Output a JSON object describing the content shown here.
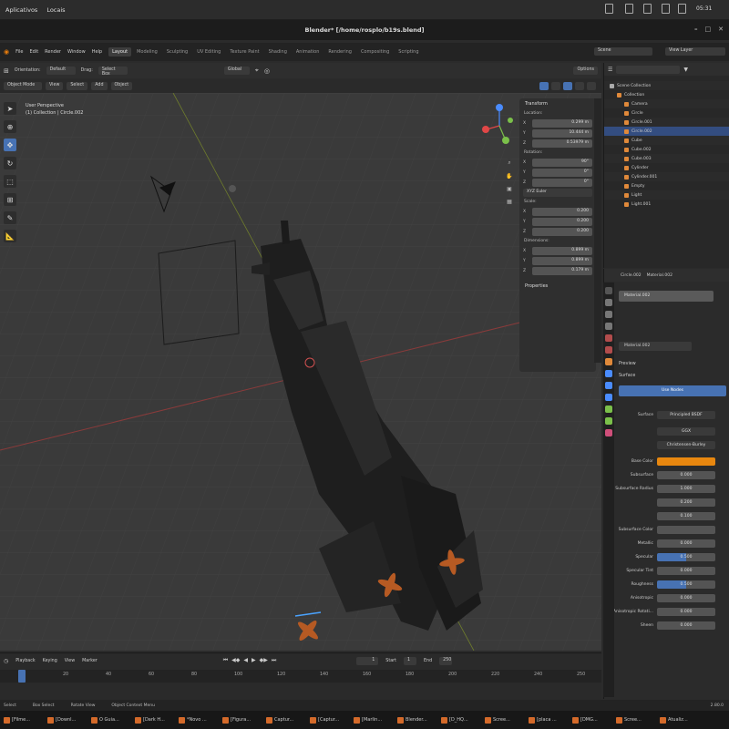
{
  "topbar": {
    "activities": "Aplicativos",
    "places": "Locais",
    "clock": "05:31"
  },
  "window": {
    "title": "Blender* [/home/rosplo/b19s.blend]"
  },
  "menu": {
    "items": [
      "File",
      "Edit",
      "Render",
      "Window",
      "Help"
    ]
  },
  "workspaces": [
    {
      "label": "Layout",
      "active": true
    },
    {
      "label": "Modeling"
    },
    {
      "label": "Sculpting"
    },
    {
      "label": "UV Editing"
    },
    {
      "label": "Texture Paint"
    },
    {
      "label": "Shading"
    },
    {
      "label": "Animation"
    },
    {
      "label": "Rendering"
    },
    {
      "label": "Compositing"
    },
    {
      "label": "Scripting"
    }
  ],
  "scene": {
    "scene_name": "Scene",
    "view_layer": "View Layer"
  },
  "header3d": {
    "orientation": "Orientation:",
    "orientation_val": "Default",
    "drag": "Drag:",
    "drag_val": "Select Box",
    "transform": "Global",
    "options": "Options"
  },
  "header3d2": {
    "mode": "Object Mode",
    "view": "View",
    "select": "Select",
    "add": "Add",
    "object": "Object"
  },
  "viewport": {
    "view_name": "User Perspective",
    "collection": "(1) Collection | Circle.002"
  },
  "npanel": {
    "title": "Transform",
    "location": "Location:",
    "loc": [
      "0.299 m",
      "10.444 m",
      "0.53979 m"
    ],
    "rotation": "Rotation:",
    "rot": [
      "90°",
      "0°",
      "0°"
    ],
    "rot_mode": "XYZ Euler",
    "scale": "Scale:",
    "scl": [
      "0.200",
      "0.200",
      "0.200"
    ],
    "dimensions": "Dimensions:",
    "dim": [
      "0.899 m",
      "0.899 m",
      "0.179 m"
    ],
    "properties": "Properties",
    "axes": [
      "X",
      "Y",
      "Z"
    ]
  },
  "outliner": {
    "items": [
      {
        "label": "Scene Collection",
        "indent": 0
      },
      {
        "label": "Collection",
        "indent": 1
      },
      {
        "label": "Camera",
        "indent": 2
      },
      {
        "label": "Circle",
        "indent": 2
      },
      {
        "label": "Circle.001",
        "indent": 2
      },
      {
        "label": "Circle.002",
        "indent": 2
      },
      {
        "label": "Cube",
        "indent": 2
      },
      {
        "label": "Cube.002",
        "indent": 2
      },
      {
        "label": "Cube.003",
        "indent": 2
      },
      {
        "label": "Cylinder",
        "indent": 2
      },
      {
        "label": "Cylinder.001",
        "indent": 2
      },
      {
        "label": "Empty",
        "indent": 2
      },
      {
        "label": "Light",
        "indent": 2
      },
      {
        "label": "Light.001",
        "indent": 2
      }
    ]
  },
  "properties": {
    "object": "Circle.002",
    "material_tab": "Material.002",
    "slot": "Material.002",
    "material": "Material.002",
    "preview": "Preview",
    "surface_section": "Surface",
    "use_nodes": "Use Nodes",
    "surface": "Surface",
    "surface_val": "Principled BSDF",
    "distribution": "GGX",
    "subsurface_method": "Christensen-Burley",
    "base_color_hex": "#e8870f",
    "rows": [
      {
        "label": "Base Color",
        "val": ""
      },
      {
        "label": "Subsurface",
        "val": "0.000"
      },
      {
        "label": "Subsurface Radius",
        "val": "1.000"
      },
      {
        "label": "",
        "val": "0.200"
      },
      {
        "label": "",
        "val": "0.100"
      },
      {
        "label": "Subsurface Color",
        "val": ""
      },
      {
        "label": "Metallic",
        "val": "0.000"
      },
      {
        "label": "Specular",
        "val": "0.500"
      },
      {
        "label": "Specular Tint",
        "val": "0.000"
      },
      {
        "label": "Roughness",
        "val": "0.500"
      },
      {
        "label": "Anisotropic",
        "val": "0.000"
      },
      {
        "label": "Anisotropic Rotati...",
        "val": "0.000"
      },
      {
        "label": "Sheen",
        "val": "0.000"
      }
    ]
  },
  "timeline": {
    "playback": "Playback",
    "keying": "Keying",
    "view": "View",
    "marker": "Marker",
    "current": "1",
    "start_label": "Start",
    "start": "1",
    "end_label": "End",
    "end": "250",
    "ticks": [
      "0",
      "20",
      "40",
      "60",
      "80",
      "100",
      "120",
      "140",
      "160",
      "180",
      "200",
      "220",
      "240",
      "250"
    ]
  },
  "statusbar": {
    "items": [
      "Select",
      "Box Select",
      "Rotate View",
      "Object Context Menu"
    ],
    "version": "2.80.0"
  },
  "taskbar": [
    "[Filme...",
    "[Downl...",
    "O Guia...",
    "[Dark H...",
    "*Novo ...",
    "[Figura...",
    "Captur...",
    "[Captur...",
    "[Marlin...",
    "Blender...",
    "[D_HQ...",
    "Scree...",
    "[placa ...",
    "[DMG...",
    "Scree...",
    "Atualiz..."
  ]
}
